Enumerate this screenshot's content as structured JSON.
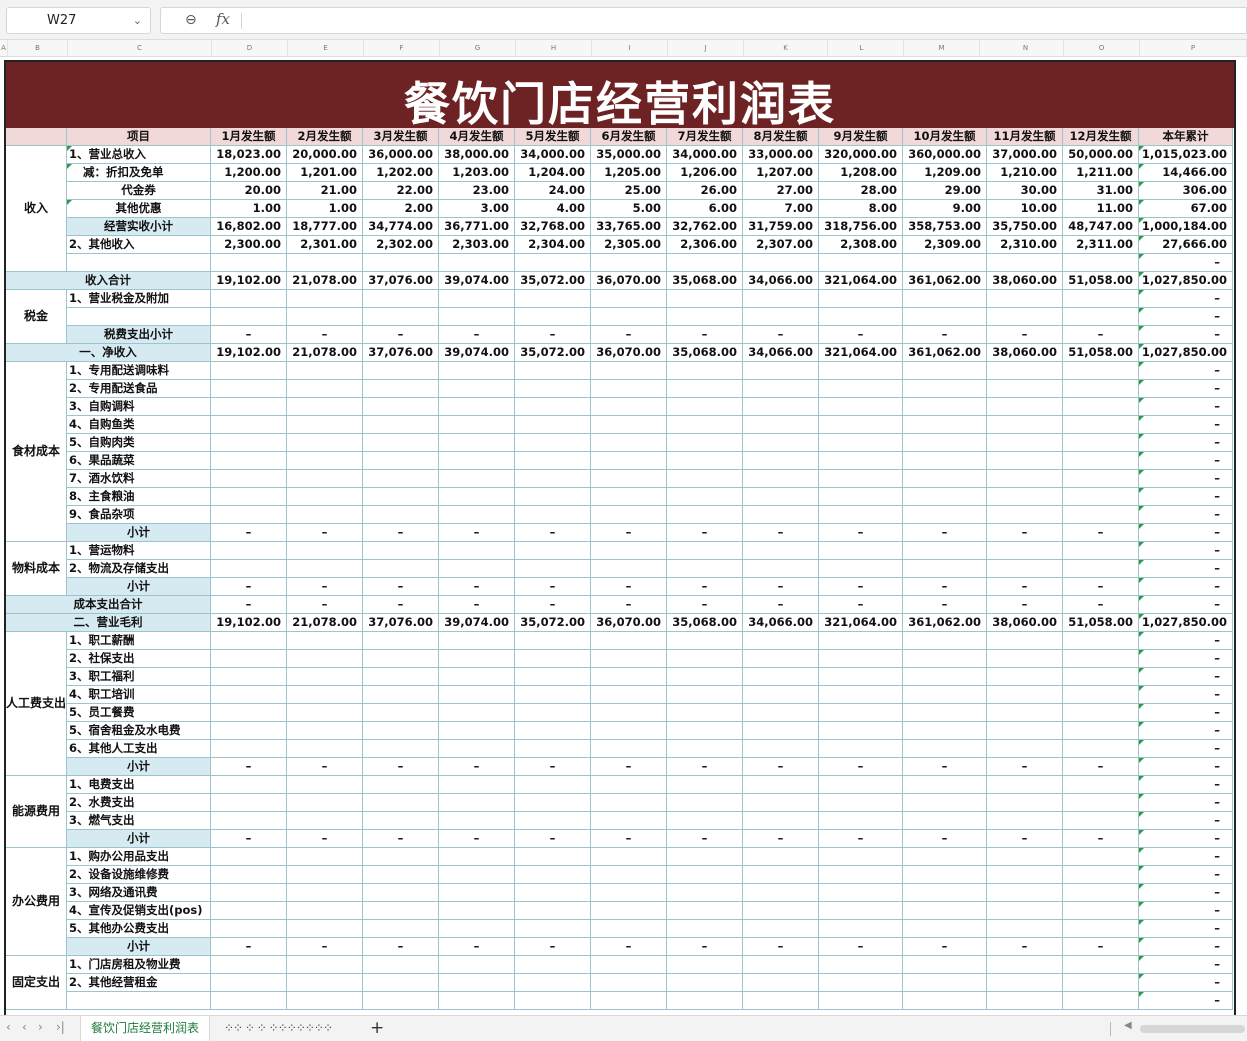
{
  "formula_bar": {
    "cell_ref": "W27",
    "formula": ""
  },
  "columns": [
    "A",
    "B",
    "C",
    "D",
    "E",
    "F",
    "G",
    "H",
    "I",
    "J",
    "K",
    "L",
    "M",
    "N",
    "O",
    "P"
  ],
  "title": "餐饮门店经营利润表",
  "header": {
    "item": "项目",
    "months": [
      "1月发生额",
      "2月发生额",
      "3月发生额",
      "4月发生额",
      "5月发生额",
      "6月发生额",
      "7月发生额",
      "8月发生额",
      "9月发生额",
      "10月发生额",
      "11月发生额",
      "12月发生额"
    ],
    "total": "本年累计"
  },
  "categories": [
    "收入",
    "税金",
    "食材成本",
    "物料成本",
    "人工费支出",
    "能源费用",
    "办公费用",
    "固定支出"
  ],
  "rows": [
    {
      "label": "1、营业总收入",
      "values": [
        "18,023.00",
        "20,000.00",
        "36,000.00",
        "38,000.00",
        "34,000.00",
        "35,000.00",
        "34,000.00",
        "33,000.00",
        "320,000.00",
        "360,000.00",
        "37,000.00",
        "50,000.00"
      ],
      "total": "1,015,023.00"
    },
    {
      "label": "减：折扣及免单",
      "values": [
        "1,200.00",
        "1,201.00",
        "1,202.00",
        "1,203.00",
        "1,204.00",
        "1,205.00",
        "1,206.00",
        "1,207.00",
        "1,208.00",
        "1,209.00",
        "1,210.00",
        "1,211.00"
      ],
      "total": "14,466.00"
    },
    {
      "label": "代金券",
      "values": [
        "20.00",
        "21.00",
        "22.00",
        "23.00",
        "24.00",
        "25.00",
        "26.00",
        "27.00",
        "28.00",
        "29.00",
        "30.00",
        "31.00"
      ],
      "total": "306.00"
    },
    {
      "label": "其他优惠",
      "values": [
        "1.00",
        "1.00",
        "2.00",
        "3.00",
        "4.00",
        "5.00",
        "6.00",
        "7.00",
        "8.00",
        "9.00",
        "10.00",
        "11.00"
      ],
      "total": "67.00"
    },
    {
      "label": "经营实收小计",
      "values": [
        "16,802.00",
        "18,777.00",
        "34,774.00",
        "36,771.00",
        "32,768.00",
        "33,765.00",
        "32,762.00",
        "31,759.00",
        "318,756.00",
        "358,753.00",
        "35,750.00",
        "48,747.00"
      ],
      "total": "1,000,184.00"
    },
    {
      "label": "2、其他收入",
      "values": [
        "2,300.00",
        "2,301.00",
        "2,302.00",
        "2,303.00",
        "2,304.00",
        "2,305.00",
        "2,306.00",
        "2,307.00",
        "2,308.00",
        "2,309.00",
        "2,310.00",
        "2,311.00"
      ],
      "total": "27,666.00"
    },
    {
      "label": "",
      "values": [
        "",
        "",
        "",
        "",
        "",
        "",
        "",
        "",
        "",
        "",
        "",
        ""
      ],
      "total": "–"
    },
    {
      "label": "收入合计",
      "values": [
        "19,102.00",
        "21,078.00",
        "37,076.00",
        "39,074.00",
        "35,072.00",
        "36,070.00",
        "35,068.00",
        "34,066.00",
        "321,064.00",
        "361,062.00",
        "38,060.00",
        "51,058.00"
      ],
      "total": "1,027,850.00"
    },
    {
      "label": "1、营业税金及附加",
      "values": [
        "",
        "",
        "",
        "",
        "",
        "",
        "",
        "",
        "",
        "",
        "",
        ""
      ],
      "total": "–"
    },
    {
      "label": "",
      "values": [
        "",
        "",
        "",
        "",
        "",
        "",
        "",
        "",
        "",
        "",
        "",
        ""
      ],
      "total": "–"
    },
    {
      "label": "税费支出小计",
      "values": [
        "–",
        "–",
        "–",
        "–",
        "–",
        "–",
        "–",
        "–",
        "–",
        "–",
        "–",
        "–"
      ],
      "total": "–"
    },
    {
      "label": "一、净收入",
      "values": [
        "19,102.00",
        "21,078.00",
        "37,076.00",
        "39,074.00",
        "35,072.00",
        "36,070.00",
        "35,068.00",
        "34,066.00",
        "321,064.00",
        "361,062.00",
        "38,060.00",
        "51,058.00"
      ],
      "total": "1,027,850.00"
    },
    {
      "label": "1、专用配送调味料",
      "values": [
        "",
        "",
        "",
        "",
        "",
        "",
        "",
        "",
        "",
        "",
        "",
        ""
      ],
      "total": "–"
    },
    {
      "label": "2、专用配送食品",
      "values": [
        "",
        "",
        "",
        "",
        "",
        "",
        "",
        "",
        "",
        "",
        "",
        ""
      ],
      "total": "–"
    },
    {
      "label": "3、自购调料",
      "values": [
        "",
        "",
        "",
        "",
        "",
        "",
        "",
        "",
        "",
        "",
        "",
        ""
      ],
      "total": "–"
    },
    {
      "label": "4、自购鱼类",
      "values": [
        "",
        "",
        "",
        "",
        "",
        "",
        "",
        "",
        "",
        "",
        "",
        ""
      ],
      "total": "–"
    },
    {
      "label": "5、自购肉类",
      "values": [
        "",
        "",
        "",
        "",
        "",
        "",
        "",
        "",
        "",
        "",
        "",
        ""
      ],
      "total": "–"
    },
    {
      "label": "6、果品蔬菜",
      "values": [
        "",
        "",
        "",
        "",
        "",
        "",
        "",
        "",
        "",
        "",
        "",
        ""
      ],
      "total": "–"
    },
    {
      "label": "7、酒水饮料",
      "values": [
        "",
        "",
        "",
        "",
        "",
        "",
        "",
        "",
        "",
        "",
        "",
        ""
      ],
      "total": "–"
    },
    {
      "label": "8、主食粮油",
      "values": [
        "",
        "",
        "",
        "",
        "",
        "",
        "",
        "",
        "",
        "",
        "",
        ""
      ],
      "total": "–"
    },
    {
      "label": "9、食品杂项",
      "values": [
        "",
        "",
        "",
        "",
        "",
        "",
        "",
        "",
        "",
        "",
        "",
        ""
      ],
      "total": "–"
    },
    {
      "label": "小计",
      "values": [
        "–",
        "–",
        "–",
        "–",
        "–",
        "–",
        "–",
        "–",
        "–",
        "–",
        "–",
        "–"
      ],
      "total": "–"
    },
    {
      "label": "1、营运物料",
      "values": [
        "",
        "",
        "",
        "",
        "",
        "",
        "",
        "",
        "",
        "",
        "",
        ""
      ],
      "total": "–"
    },
    {
      "label": "2、物流及存储支出",
      "values": [
        "",
        "",
        "",
        "",
        "",
        "",
        "",
        "",
        "",
        "",
        "",
        ""
      ],
      "total": "–"
    },
    {
      "label": "小计",
      "values": [
        "–",
        "–",
        "–",
        "–",
        "–",
        "–",
        "–",
        "–",
        "–",
        "–",
        "–",
        "–"
      ],
      "total": "–"
    },
    {
      "label": "成本支出合计",
      "values": [
        "–",
        "–",
        "–",
        "–",
        "–",
        "–",
        "–",
        "–",
        "–",
        "–",
        "–",
        "–"
      ],
      "total": "–"
    },
    {
      "label": "二、营业毛利",
      "values": [
        "19,102.00",
        "21,078.00",
        "37,076.00",
        "39,074.00",
        "35,072.00",
        "36,070.00",
        "35,068.00",
        "34,066.00",
        "321,064.00",
        "361,062.00",
        "38,060.00",
        "51,058.00"
      ],
      "total": "1,027,850.00"
    },
    {
      "label": "1、职工薪酬",
      "values": [
        "",
        "",
        "",
        "",
        "",
        "",
        "",
        "",
        "",
        "",
        "",
        ""
      ],
      "total": "–"
    },
    {
      "label": "2、社保支出",
      "values": [
        "",
        "",
        "",
        "",
        "",
        "",
        "",
        "",
        "",
        "",
        "",
        ""
      ],
      "total": "–"
    },
    {
      "label": "3、职工福利",
      "values": [
        "",
        "",
        "",
        "",
        "",
        "",
        "",
        "",
        "",
        "",
        "",
        ""
      ],
      "total": "–"
    },
    {
      "label": "4、职工培训",
      "values": [
        "",
        "",
        "",
        "",
        "",
        "",
        "",
        "",
        "",
        "",
        "",
        ""
      ],
      "total": "–"
    },
    {
      "label": "5、员工餐费",
      "values": [
        "",
        "",
        "",
        "",
        "",
        "",
        "",
        "",
        "",
        "",
        "",
        ""
      ],
      "total": "–"
    },
    {
      "label": "5、宿舍租金及水电费",
      "values": [
        "",
        "",
        "",
        "",
        "",
        "",
        "",
        "",
        "",
        "",
        "",
        ""
      ],
      "total": "–"
    },
    {
      "label": "6、其他人工支出",
      "values": [
        "",
        "",
        "",
        "",
        "",
        "",
        "",
        "",
        "",
        "",
        "",
        ""
      ],
      "total": "–"
    },
    {
      "label": "小计",
      "values": [
        "–",
        "–",
        "–",
        "–",
        "–",
        "–",
        "–",
        "–",
        "–",
        "–",
        "–",
        "–"
      ],
      "total": "–"
    },
    {
      "label": "1、电费支出",
      "values": [
        "",
        "",
        "",
        "",
        "",
        "",
        "",
        "",
        "",
        "",
        "",
        ""
      ],
      "total": "–"
    },
    {
      "label": "2、水费支出",
      "values": [
        "",
        "",
        "",
        "",
        "",
        "",
        "",
        "",
        "",
        "",
        "",
        ""
      ],
      "total": "–"
    },
    {
      "label": "3、燃气支出",
      "values": [
        "",
        "",
        "",
        "",
        "",
        "",
        "",
        "",
        "",
        "",
        "",
        ""
      ],
      "total": "–"
    },
    {
      "label": "小计",
      "values": [
        "–",
        "–",
        "–",
        "–",
        "–",
        "–",
        "–",
        "–",
        "–",
        "–",
        "–",
        "–"
      ],
      "total": "–"
    },
    {
      "label": "1、购办公用品支出",
      "values": [
        "",
        "",
        "",
        "",
        "",
        "",
        "",
        "",
        "",
        "",
        "",
        ""
      ],
      "total": "–"
    },
    {
      "label": "2、设备设施维修费",
      "values": [
        "",
        "",
        "",
        "",
        "",
        "",
        "",
        "",
        "",
        "",
        "",
        ""
      ],
      "total": "–"
    },
    {
      "label": "3、网络及通讯费",
      "values": [
        "",
        "",
        "",
        "",
        "",
        "",
        "",
        "",
        "",
        "",
        "",
        ""
      ],
      "total": "–"
    },
    {
      "label": "4、宣传及促销支出(pos)",
      "values": [
        "",
        "",
        "",
        "",
        "",
        "",
        "",
        "",
        "",
        "",
        "",
        ""
      ],
      "total": "–"
    },
    {
      "label": "5、其他办公费支出",
      "values": [
        "",
        "",
        "",
        "",
        "",
        "",
        "",
        "",
        "",
        "",
        "",
        ""
      ],
      "total": "–"
    },
    {
      "label": "小计",
      "values": [
        "–",
        "–",
        "–",
        "–",
        "–",
        "–",
        "–",
        "–",
        "–",
        "–",
        "–",
        "–"
      ],
      "total": "–"
    },
    {
      "label": "1、门店房租及物业费",
      "values": [
        "",
        "",
        "",
        "",
        "",
        "",
        "",
        "",
        "",
        "",
        "",
        ""
      ],
      "total": "–"
    },
    {
      "label": "2、其他经营租金",
      "values": [
        "",
        "",
        "",
        "",
        "",
        "",
        "",
        "",
        "",
        "",
        "",
        ""
      ],
      "total": "–"
    },
    {
      "label": "",
      "values": [
        "",
        "",
        "",
        "",
        "",
        "",
        "",
        "",
        "",
        "",
        "",
        ""
      ],
      "total": "–"
    }
  ],
  "tabs": {
    "active": "餐饮门店经营利润表",
    "other": "⁘⁘ ⁘ ⁘ ⁘⁘⁘⁘⁘⁘⁘"
  },
  "colors": {
    "title_bg": "#6d2324",
    "header_bg": "#f1d9da",
    "subtotal_bg": "#d6eaf1",
    "grid_line": "#9bc4cf"
  }
}
